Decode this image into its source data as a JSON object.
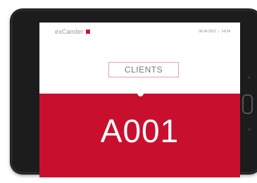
{
  "brand": {
    "name": "exCander",
    "accent_color": "#cc1632"
  },
  "header": {
    "date": "06.04.2017",
    "time": "14:34"
  },
  "queue": {
    "section_label": "CLIENTS",
    "ticket_number": "A001",
    "panel_color": "#c8102e"
  }
}
